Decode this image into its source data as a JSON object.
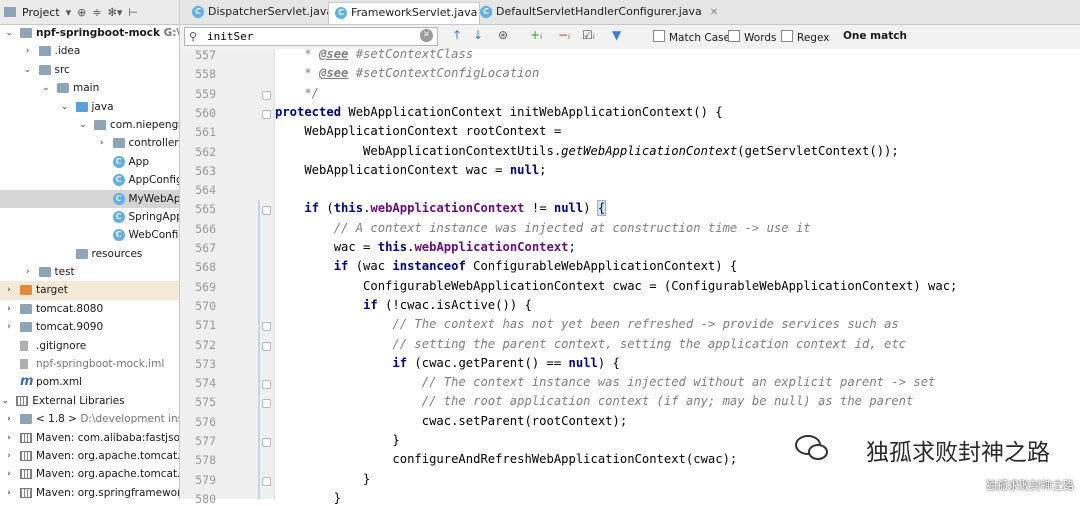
{
  "project_panel": {
    "title": "Project",
    "tree": [
      {
        "depth": 0,
        "arrow": "down",
        "icon": "folder",
        "label": "npf-springboot-mock",
        "extra": " G:\\sou",
        "bold": true
      },
      {
        "depth": 1,
        "arrow": "right",
        "icon": "folder",
        "label": ".idea"
      },
      {
        "depth": 1,
        "arrow": "down",
        "icon": "folder",
        "label": "src"
      },
      {
        "depth": 2,
        "arrow": "down",
        "icon": "folder",
        "label": "main"
      },
      {
        "depth": 3,
        "arrow": "down",
        "icon": "folder-blue",
        "label": "java"
      },
      {
        "depth": 4,
        "arrow": "down",
        "icon": "folder",
        "label": "com.niepengfei"
      },
      {
        "depth": 5,
        "arrow": "right",
        "icon": "folder",
        "label": "controller"
      },
      {
        "depth": 5,
        "arrow": "",
        "icon": "class",
        "label": "App"
      },
      {
        "depth": 5,
        "arrow": "",
        "icon": "class",
        "label": "AppConfig"
      },
      {
        "depth": 5,
        "arrow": "",
        "icon": "class",
        "label": "MyWebApp",
        "selected": true
      },
      {
        "depth": 5,
        "arrow": "",
        "icon": "class",
        "label": "SpringAppli"
      },
      {
        "depth": 5,
        "arrow": "",
        "icon": "class",
        "label": "WebConfig"
      },
      {
        "depth": 3,
        "arrow": "",
        "icon": "folder",
        "label": "resources"
      },
      {
        "depth": 1,
        "arrow": "right",
        "icon": "folder",
        "label": "test"
      },
      {
        "depth": 0,
        "arrow": "right",
        "icon": "folder-orange",
        "label": "target",
        "tinted": true
      },
      {
        "depth": 0,
        "arrow": "right",
        "icon": "folder",
        "label": "tomcat.8080"
      },
      {
        "depth": 0,
        "arrow": "right",
        "icon": "folder",
        "label": "tomcat.9090"
      },
      {
        "depth": 0,
        "arrow": "",
        "icon": "file",
        "label": ".gitignore"
      },
      {
        "depth": 0,
        "arrow": "",
        "icon": "file",
        "label": "npf-springboot-mock.iml",
        "grey": true
      },
      {
        "depth": 0,
        "arrow": "",
        "icon": "maven-file",
        "label": "pom.xml"
      },
      {
        "depth": -1,
        "arrow": "down",
        "icon": "library",
        "label": "External Libraries"
      },
      {
        "depth": 0,
        "arrow": "right",
        "icon": "folder",
        "label": "< 1.8 >",
        "extra": " D:\\development ins"
      },
      {
        "depth": 0,
        "arrow": "right",
        "icon": "maven",
        "label": "Maven: com.alibaba:fastjson"
      },
      {
        "depth": 0,
        "arrow": "right",
        "icon": "maven",
        "label": "Maven: org.apache.tomcat."
      },
      {
        "depth": 0,
        "arrow": "right",
        "icon": "maven",
        "label": "Maven: org.apache.tomcat."
      },
      {
        "depth": 0,
        "arrow": "right",
        "icon": "maven",
        "label": "Maven: org.springframewor"
      }
    ]
  },
  "tabs": [
    {
      "label": "DispatcherServlet.java",
      "active": false
    },
    {
      "label": "FrameworkServlet.java",
      "active": true
    },
    {
      "label": "DefaultServletHandlerConfigurer.java",
      "active": false
    }
  ],
  "search": {
    "value": "initSer",
    "options": [
      "Match Case",
      "Words",
      "Regex"
    ],
    "result": "One match"
  },
  "code_lines": [
    {
      "no": "557",
      "segs": [
        [
          "    * ",
          "cm"
        ],
        [
          "@see",
          "doctag"
        ],
        [
          " #setContextClass",
          "cm"
        ]
      ]
    },
    {
      "no": "558",
      "segs": [
        [
          "    * ",
          "cm"
        ],
        [
          "@see",
          "doctag"
        ],
        [
          " #setContextConfigLocation",
          "cm"
        ]
      ]
    },
    {
      "no": "559",
      "segs": [
        [
          "    */",
          "cm"
        ]
      ]
    },
    {
      "no": "560",
      "segs": [
        [
          "protected ",
          "kw"
        ],
        [
          "WebApplicationContext initWebApplicationContext() {",
          ""
        ]
      ]
    },
    {
      "no": "561",
      "segs": [
        [
          "    WebApplicationContext rootContext =",
          ""
        ]
      ]
    },
    {
      "no": "562",
      "segs": [
        [
          "            WebApplicationContextUtils.",
          ""
        ],
        [
          "getWebApplicationContext",
          "it"
        ],
        [
          "(getServletContext());",
          ""
        ]
      ]
    },
    {
      "no": "563",
      "segs": [
        [
          "    WebApplicationContext wac = ",
          ""
        ],
        [
          "null",
          "kw"
        ],
        [
          ";",
          ""
        ]
      ]
    },
    {
      "no": "564",
      "segs": []
    },
    {
      "no": "565",
      "segs": [
        [
          "    ",
          ""
        ],
        [
          "if ",
          "kw"
        ],
        [
          "(",
          ""
        ],
        [
          "this",
          "kw"
        ],
        [
          ".",
          ""
        ],
        [
          "webApplicationContext",
          "fld"
        ],
        [
          " != ",
          ""
        ],
        [
          "null",
          "kw"
        ],
        [
          ") ",
          ""
        ],
        [
          "{",
          "hl"
        ]
      ]
    },
    {
      "no": "566",
      "segs": [
        [
          "        // A context instance was injected at construction time -> use it",
          "cm"
        ]
      ]
    },
    {
      "no": "567",
      "segs": [
        [
          "        wac = ",
          ""
        ],
        [
          "this",
          "kw"
        ],
        [
          ".",
          ""
        ],
        [
          "webApplicationContext",
          "fld"
        ],
        [
          ";",
          ""
        ]
      ]
    },
    {
      "no": "568",
      "segs": [
        [
          "        ",
          ""
        ],
        [
          "if ",
          "kw"
        ],
        [
          "(wac ",
          ""
        ],
        [
          "instanceof ",
          "kw"
        ],
        [
          "ConfigurableWebApplicationContext) {",
          ""
        ]
      ]
    },
    {
      "no": "569",
      "segs": [
        [
          "            ConfigurableWebApplicationContext cwac = (ConfigurableWebApplicationContext) wac;",
          ""
        ]
      ]
    },
    {
      "no": "570",
      "segs": [
        [
          "            ",
          ""
        ],
        [
          "if ",
          "kw"
        ],
        [
          "(!cwac.isActive()) {",
          ""
        ]
      ]
    },
    {
      "no": "571",
      "segs": [
        [
          "                // The context has not yet been refreshed -> provide services such as",
          "cm"
        ]
      ]
    },
    {
      "no": "572",
      "segs": [
        [
          "                // setting the parent context, setting the application context id, etc",
          "cm"
        ]
      ]
    },
    {
      "no": "573",
      "segs": [
        [
          "                ",
          ""
        ],
        [
          "if ",
          "kw"
        ],
        [
          "(cwac.getParent() == ",
          ""
        ],
        [
          "null",
          "kw"
        ],
        [
          ") {",
          ""
        ]
      ]
    },
    {
      "no": "574",
      "segs": [
        [
          "                    // The context instance was injected without an explicit parent -> set",
          "cm"
        ]
      ]
    },
    {
      "no": "575",
      "segs": [
        [
          "                    // the root application context (if any; may be null) as the parent",
          "cm"
        ]
      ]
    },
    {
      "no": "576",
      "segs": [
        [
          "                    cwac.setParent(rootContext);",
          ""
        ]
      ]
    },
    {
      "no": "577",
      "segs": [
        [
          "                }",
          ""
        ]
      ]
    },
    {
      "no": "578",
      "segs": [
        [
          "                configureAndRefreshWebApplicationContext(cwac);",
          ""
        ]
      ]
    },
    {
      "no": "579",
      "segs": [
        [
          "            }",
          ""
        ]
      ]
    },
    {
      "no": "580",
      "segs": [
        [
          "        }",
          ""
        ]
      ]
    }
  ],
  "watermark": {
    "main": "独孤求败封神之路",
    "small": "独孤求败封神之路"
  }
}
